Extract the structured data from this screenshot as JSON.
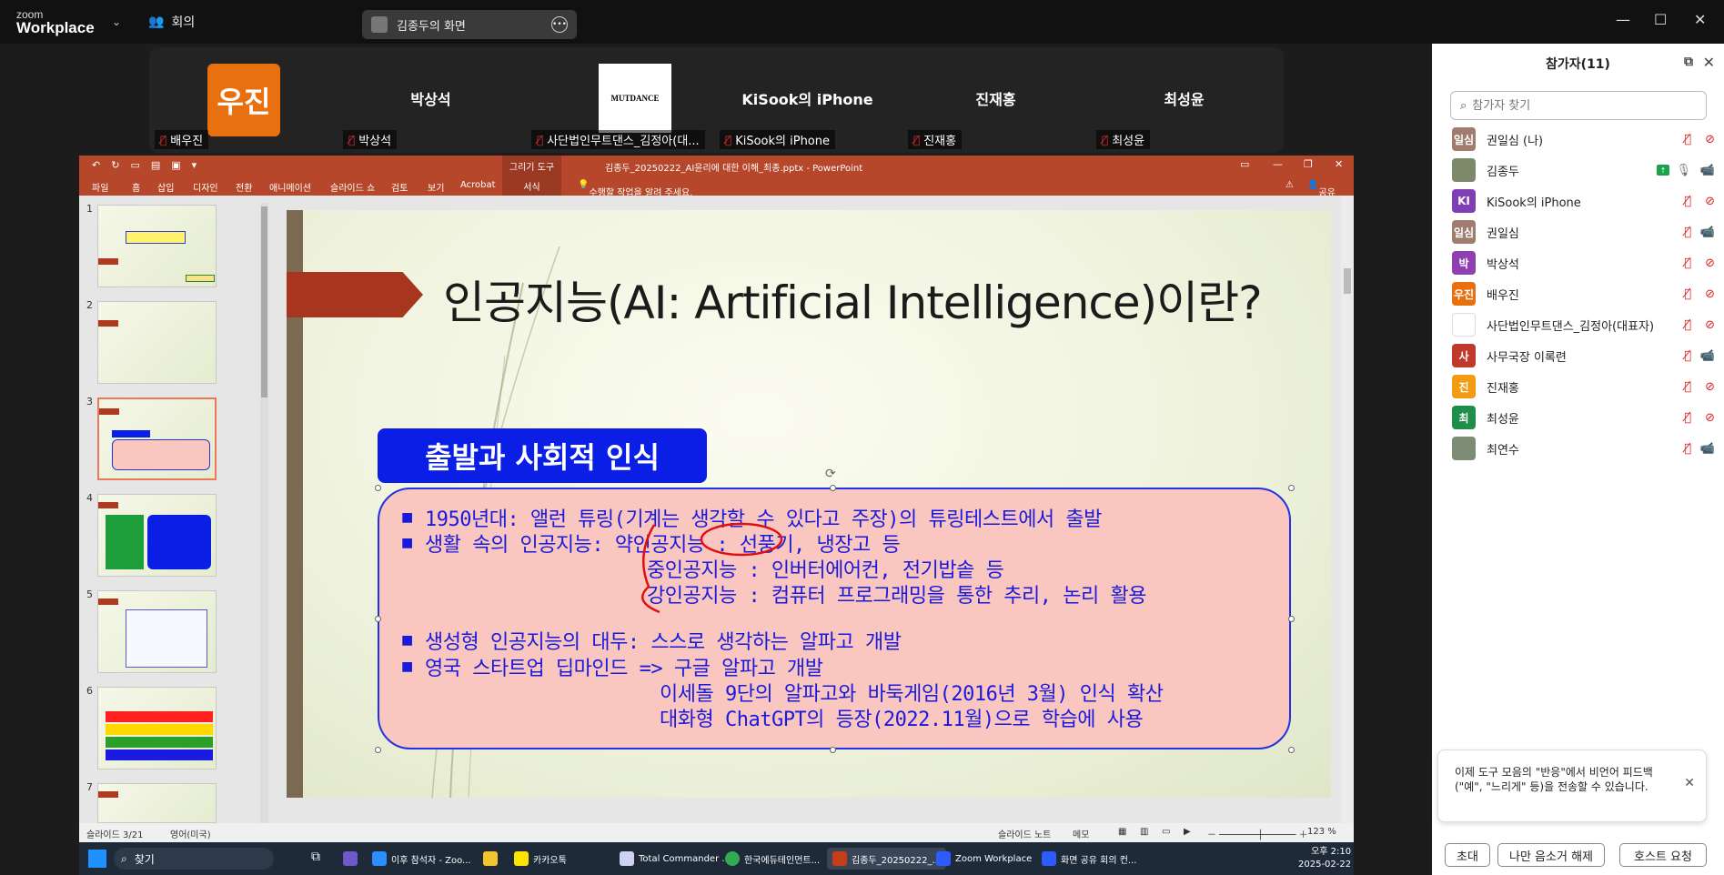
{
  "zoom": {
    "logo_line1": "zoom",
    "logo_line2": "Workplace",
    "meeting_label": "회의",
    "share_title": "김종두의 화면"
  },
  "gallery": [
    {
      "display": "우진",
      "label": "배우진",
      "type": "orange"
    },
    {
      "display": "박상석",
      "label": "박상석",
      "type": "name"
    },
    {
      "display": "MUTDANCE",
      "label": "사단법인무트댄스_김정아(대...",
      "type": "logo"
    },
    {
      "display": "KiSook의 iPhone",
      "label": "KiSook의 iPhone",
      "type": "name"
    },
    {
      "display": "진재홍",
      "label": "진재홍",
      "type": "name"
    },
    {
      "display": "최성윤",
      "label": "최성윤",
      "type": "name"
    }
  ],
  "ppt": {
    "drawing_tools": "그리기 도구",
    "window_title": "김종두_20250222_AI윤리에 대한 이해_최종.pptx - PowerPoint",
    "tabs": [
      "파일",
      "홈",
      "삽입",
      "디자인",
      "전환",
      "애니메이션",
      "슬라이드 쇼",
      "검토",
      "보기",
      "Acrobat"
    ],
    "format_tab": "서식",
    "tell_me": "수행할 작업을 알려 주세요.",
    "share": "공유",
    "slide": {
      "title": "인공지능(AI: Artificial Intelligence)이란?",
      "subheader": "출발과 사회적 인식",
      "lines": [
        "1950년대: 앨런 튜링(기계는 생각할 수 있다고 주장)의 튜링테스트에서 출발",
        "생활 속의 인공지능: 약인공지능 : 선풍기, 냉장고 등",
        "중인공지능 : 인버터에어컨, 전기밥솥 등",
        "강인공지능 : 컴퓨터 프로그래밍을 통한 추리, 논리 활용",
        "생성형 인공지능의 대두: 스스로 생각하는 알파고 개발",
        "영국 스타트업 딥마인드 => 구글 알파고 개발",
        "이세돌 9단의 알파고와 바둑게임(2016년 3월) 인식 확산",
        "대화형 ChatGPT의 등장(2022.11월)으로 학습에 사용"
      ]
    },
    "thumb_numbers": [
      "1",
      "2",
      "3",
      "4",
      "5",
      "6",
      "7"
    ],
    "status": {
      "slide_count": "슬라이드 3/21",
      "language": "영어(미국)",
      "notes": "슬라이드 노트",
      "comments": "메모",
      "zoom": "123 %"
    }
  },
  "taskbar": {
    "search": "찾기",
    "items": [
      "이후 참석자 - Zoo...",
      "카카오톡",
      "Total Commander ...",
      "한국에듀테인먼트...",
      "김종두_20250222_...",
      "Zoom Workplace",
      "화면 공유 회의 컨..."
    ],
    "time": "오후 2:10",
    "date": "2025-02-22"
  },
  "participants": {
    "header": "참가자(11)",
    "search_placeholder": "참가자 찾기",
    "list": [
      {
        "avatar": "일심",
        "name": "권일심 (나)",
        "color": "#a07c6e",
        "mic": "off",
        "cam": "off"
      },
      {
        "avatar": "",
        "name": "김종두",
        "color": "#7c8a6a",
        "mic": "on",
        "cam": "on",
        "sharing": true
      },
      {
        "avatar": "KI",
        "name": "KiSook의 iPhone",
        "color": "#7e3fb4",
        "mic": "off",
        "cam": "off"
      },
      {
        "avatar": "일심",
        "name": "권일심",
        "color": "#a07c6e",
        "mic": "off",
        "cam": "on"
      },
      {
        "avatar": "박",
        "name": "박상석",
        "color": "#8e3fb0",
        "mic": "off",
        "cam": "off"
      },
      {
        "avatar": "우진",
        "name": "배우진",
        "color": "#e8700f",
        "mic": "off",
        "cam": "off"
      },
      {
        "avatar": "",
        "name": "사단법인무트댄스_김정아(대표자)",
        "color": "#ffffff",
        "mic": "off",
        "cam": "off"
      },
      {
        "avatar": "사",
        "name": "사무국장 이록련",
        "color": "#c0392b",
        "mic": "off",
        "cam": "on"
      },
      {
        "avatar": "진",
        "name": "진재홍",
        "color": "#f39c12",
        "mic": "off",
        "cam": "off"
      },
      {
        "avatar": "최",
        "name": "최성윤",
        "color": "#1e8e4a",
        "mic": "off",
        "cam": "off"
      },
      {
        "avatar": "",
        "name": "최연수",
        "color": "#7d8c74",
        "mic": "off",
        "cam": "on"
      }
    ],
    "notice": "이제 도구 모음의 \"반응\"에서 비언어 피드백(\"예\", \"느리게\" 등)을 전송할 수 있습니다.",
    "buttons": {
      "invite": "초대",
      "unmute_me": "나만 음소거 해제",
      "request_host": "호스트 요청"
    }
  }
}
